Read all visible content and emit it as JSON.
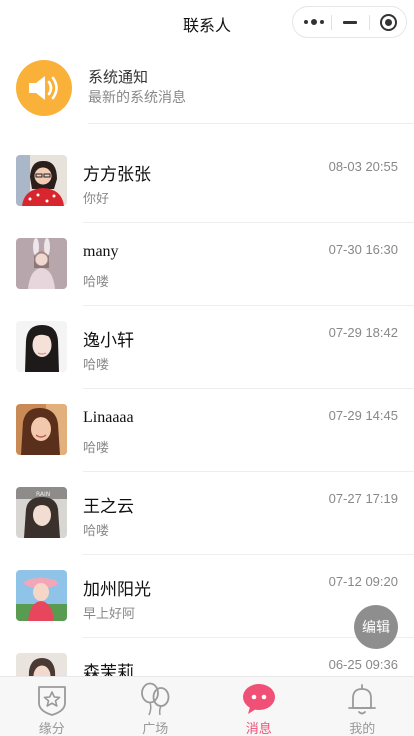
{
  "header": {
    "title": "联系人"
  },
  "notice": {
    "title": "系统通知",
    "subtitle": "最新的系统消息"
  },
  "messages": [
    {
      "name": "方方张张",
      "preview": "你好",
      "time": "08-03 20:55"
    },
    {
      "name": "many",
      "preview": "哈喽",
      "time": "07-30 16:30"
    },
    {
      "name": "逸小轩",
      "preview": "哈喽",
      "time": "07-29 18:42"
    },
    {
      "name": "Linaaaa",
      "preview": "哈喽",
      "time": "07-29 14:45"
    },
    {
      "name": "王之云",
      "preview": "哈喽",
      "time": "07-27 17:19"
    },
    {
      "name": "加州阳光",
      "preview": "早上好阿",
      "time": "07-12 09:20"
    },
    {
      "name": "森茉莉",
      "preview": "",
      "time": "06-25 09:36"
    }
  ],
  "edit_button": {
    "label": "编辑"
  },
  "tabbar": {
    "tabs": [
      {
        "label": "缘分",
        "icon": "star-badge-icon"
      },
      {
        "label": "广场",
        "icon": "balloons-icon"
      },
      {
        "label": "消息",
        "icon": "chat-bubble-icon"
      },
      {
        "label": "我的",
        "icon": "bell-icon"
      }
    ]
  },
  "colors": {
    "accent": "#f05076",
    "notice_icon_bg": "#f9b13a",
    "fab_bg": "#8e8e8e"
  }
}
